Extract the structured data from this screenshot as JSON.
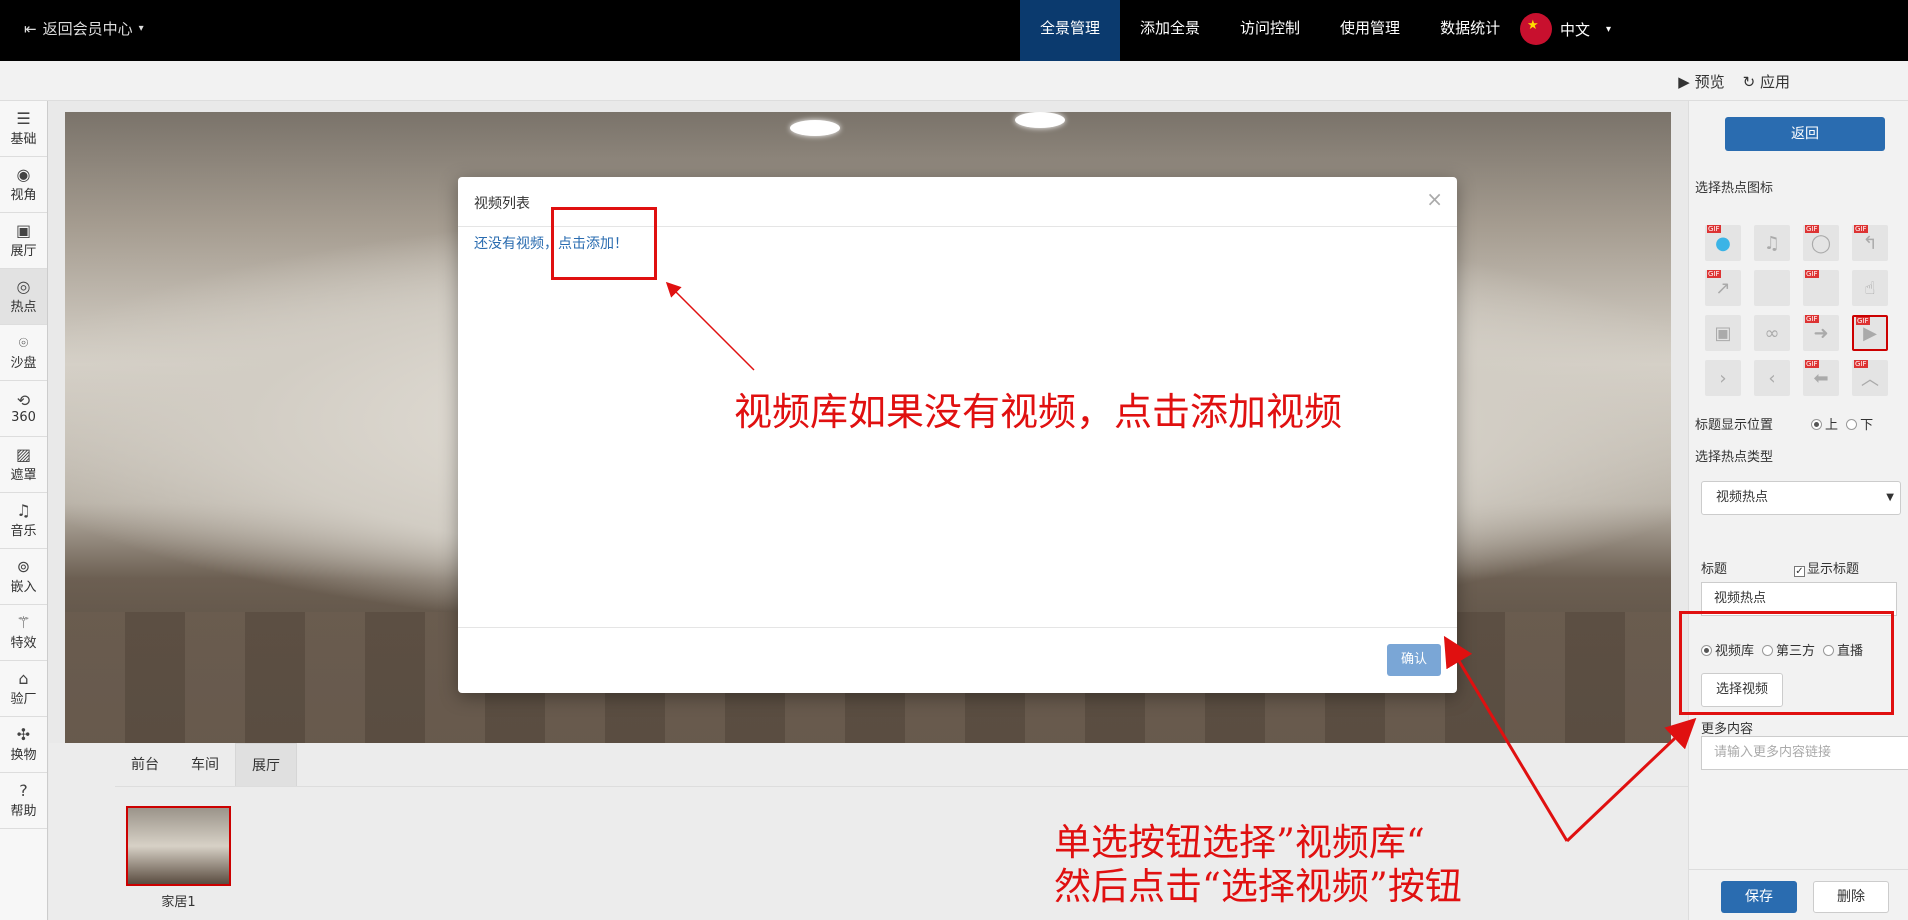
{
  "topbar": {
    "back_label": "返回会员中心",
    "nav": [
      "全景管理",
      "添加全景",
      "访问控制",
      "使用管理",
      "数据统计"
    ],
    "language": "中文"
  },
  "subbar": {
    "preview": "预览",
    "apply": "应用"
  },
  "sidebar": {
    "items": [
      {
        "label": "基础",
        "icon": "list-icon"
      },
      {
        "label": "视角",
        "icon": "eye-icon"
      },
      {
        "label": "展厅",
        "icon": "gallery-icon"
      },
      {
        "label": "热点",
        "icon": "hotspot-icon"
      },
      {
        "label": "沙盘",
        "icon": "map-pin-icon"
      },
      {
        "label": "360",
        "icon": "rotate-360-icon"
      },
      {
        "label": "遮罩",
        "icon": "image-icon"
      },
      {
        "label": "音乐",
        "icon": "music-icon"
      },
      {
        "label": "嵌入",
        "icon": "embed-icon"
      },
      {
        "label": "特效",
        "icon": "magic-wand-icon"
      },
      {
        "label": "验厂",
        "icon": "factory-icon"
      },
      {
        "label": "换物",
        "icon": "swap-icon"
      },
      {
        "label": "帮助",
        "icon": "help-icon"
      }
    ]
  },
  "scenes": {
    "tabs": [
      "前台",
      "车间",
      "展厅"
    ],
    "thumb_label": "家居1"
  },
  "right_panel": {
    "back_button": "返回",
    "hotspot_icon_title": "选择热点图标",
    "title_position_label": "标题显示位置",
    "title_position_options": [
      "上",
      "下"
    ],
    "hotspot_type_label": "选择热点类型",
    "hotspot_type_value": "视频热点",
    "title_label": "标题",
    "show_title_label": "显示标题",
    "title_value": "视频热点",
    "source_options": [
      "视频库",
      "第三方",
      "直播"
    ],
    "choose_video_button": "选择视频",
    "more_content_label": "更多内容",
    "more_content_placeholder": "请输入更多内容链接",
    "save_button": "保存",
    "delete_button": "删除"
  },
  "modal": {
    "title": "视频列表",
    "close": "×",
    "empty_text": "还没有视频，点击添加！",
    "confirm_button": "确认"
  },
  "annotations": {
    "note1": "视频库如果没有视频，点击添加视频",
    "note2_line1": "单选按钮选择”视频库“",
    "note2_line2": "然后点击“选择视频”按钮",
    "color": "#e01010"
  },
  "colors": {
    "primary": "#2a6cb0",
    "nav_active": "#0b3a6e"
  }
}
